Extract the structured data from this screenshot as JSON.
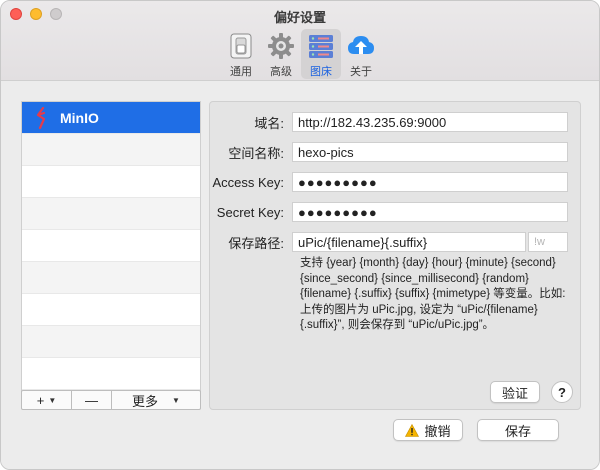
{
  "window": {
    "title": "偏好设置"
  },
  "toolbar": {
    "items": [
      {
        "label": "通用",
        "icon": "switch-icon"
      },
      {
        "label": "高级",
        "icon": "gear-icon"
      },
      {
        "label": "图床",
        "icon": "image-host-icon",
        "active": true
      },
      {
        "label": "关于",
        "icon": "cloud-upload-icon"
      }
    ]
  },
  "sidebar": {
    "selected_label": "MinIO",
    "selected_icon": "minio-icon",
    "add_label": "+",
    "remove_label": "—",
    "more_label": "更多"
  },
  "form": {
    "domain": {
      "label": "域名:",
      "value": "http://182.43.235.69:9000"
    },
    "bucket": {
      "label": "空间名称:",
      "value": "hexo-pics"
    },
    "access_key": {
      "label": "Access Key:",
      "value": "●●●●●●●●●"
    },
    "secret_key": {
      "label": "Secret Key:",
      "value": "●●●●●●●●●"
    },
    "save_path": {
      "label": "保存路径:",
      "value": "uPic/{filename}{.suffix}",
      "suffix_placeholder": "!w"
    },
    "hint": "支持 {year} {month} {day} {hour} {minute} {second} {since_second} {since_millisecond} {random} {filename} {.suffix} {suffix} {mimetype} 等变量。比如: 上传的图片为 uPic.jpg, 设定为 “uPic/{filename}{.suffix}”, 则会保存到 “uPic/uPic.jpg”。"
  },
  "buttons": {
    "verify": "验证",
    "help": "?",
    "revert": "撤销",
    "save": "保存"
  },
  "colors": {
    "accent": "#1f6ee6",
    "warning": "#f5b400"
  }
}
